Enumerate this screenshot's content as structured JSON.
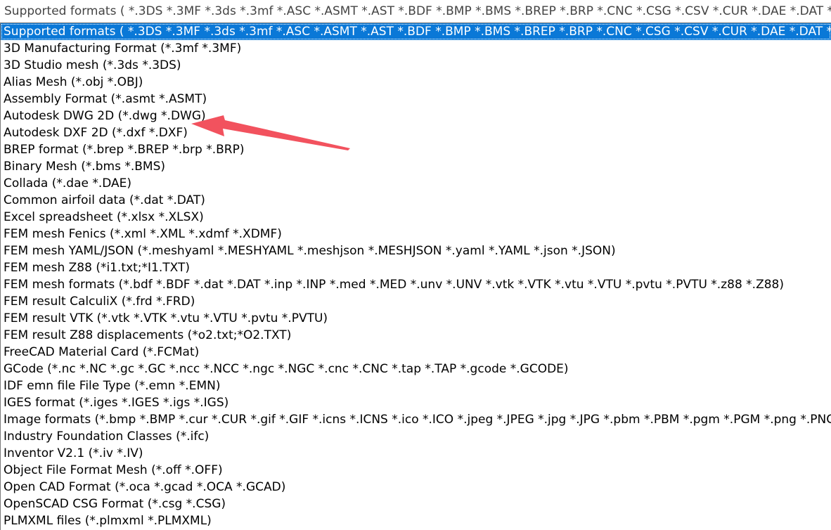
{
  "combo": {
    "value": "Supported formats ( *.3DS *.3MF *.3ds *.3mf *.ASC *.ASMT *.AST *.BDF *.BMP *.BMS *.BREP *.BRP *.CNC *.CSG *.CSV *.CUR *.DAE *.DAT *.D"
  },
  "list": {
    "items": [
      {
        "label": "Supported formats ( *.3DS *.3MF *.3ds *.3mf *.ASC *.ASMT *.AST *.BDF *.BMP *.BMS *.BREP *.BRP *.CNC *.CSG *.CSV *.CUR *.DAE *.DAT *.D",
        "selected": true
      },
      {
        "label": "3D Manufacturing Format (*.3mf *.3MF)"
      },
      {
        "label": "3D Studio mesh (*.3ds *.3DS)"
      },
      {
        "label": "Alias Mesh (*.obj *.OBJ)"
      },
      {
        "label": "Assembly Format (*.asmt *.ASMT)"
      },
      {
        "label": "Autodesk DWG 2D (*.dwg *.DWG)"
      },
      {
        "label": "Autodesk DXF 2D (*.dxf *.DXF)"
      },
      {
        "label": "BREP format (*.brep *.BREP *.brp *.BRP)"
      },
      {
        "label": "Binary Mesh (*.bms *.BMS)"
      },
      {
        "label": "Collada (*.dae *.DAE)"
      },
      {
        "label": "Common airfoil data (*.dat *.DAT)"
      },
      {
        "label": "Excel spreadsheet (*.xlsx *.XLSX)"
      },
      {
        "label": "FEM mesh Fenics (*.xml *.XML *.xdmf *.XDMF)"
      },
      {
        "label": "FEM mesh YAML/JSON (*.meshyaml *.MESHYAML *.meshjson *.MESHJSON *.yaml *.YAML *.json *.JSON)"
      },
      {
        "label": "FEM mesh Z88 (*i1.txt;*I1.TXT)"
      },
      {
        "label": "FEM mesh formats (*.bdf *.BDF *.dat *.DAT *.inp *.INP *.med *.MED *.unv *.UNV *.vtk *.VTK *.vtu *.VTU *.pvtu *.PVTU *.z88 *.Z88)"
      },
      {
        "label": "FEM result CalculiX (*.frd *.FRD)"
      },
      {
        "label": "FEM result VTK (*.vtk *.VTK *.vtu *.VTU *.pvtu *.PVTU)"
      },
      {
        "label": "FEM result Z88 displacements (*o2.txt;*O2.TXT)"
      },
      {
        "label": "FreeCAD Material Card (*.FCMat)"
      },
      {
        "label": "GCode (*.nc *.NC *.gc *.GC *.ncc *.NCC *.ngc *.NGC *.cnc *.CNC *.tap *.TAP *.gcode *.GCODE)"
      },
      {
        "label": "IDF emn file File Type (*.emn *.EMN)"
      },
      {
        "label": "IGES format (*.iges *.IGES *.igs *.IGS)"
      },
      {
        "label": "Image formats (*.bmp *.BMP *.cur *.CUR *.gif *.GIF *.icns *.ICNS *.ico *.ICO *.jpeg *.JPEG *.jpg *.JPG *.pbm *.PBM *.pgm *.PGM *.png *.PNG"
      },
      {
        "label": "Industry Foundation Classes (*.ifc)"
      },
      {
        "label": "Inventor V2.1 (*.iv *.IV)"
      },
      {
        "label": "Object File Format Mesh (*.off *.OFF)"
      },
      {
        "label": "Open CAD Format (*.oca *.gcad *.OCA *.GCAD)"
      },
      {
        "label": "OpenSCAD CSG Format (*.csg *.CSG)"
      },
      {
        "label": "PLMXML files (*.plmxml *.PLMXML)"
      }
    ]
  },
  "colors": {
    "selection": "#0a78d7",
    "arrow": "#f2525e"
  },
  "arrow_icon": "red-arrow-annotation"
}
